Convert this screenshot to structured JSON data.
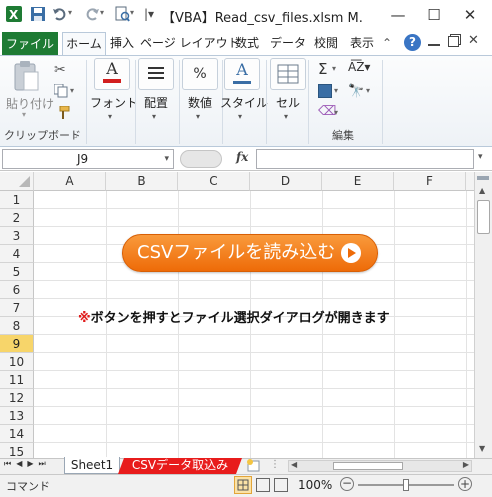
{
  "title_bar": {
    "title": "【VBA】Read_csv_files.xlsm M.",
    "minimize": "—",
    "maximize": "☐",
    "close": "✕"
  },
  "ribbon": {
    "file_tab": "ファイル",
    "tabs": [
      "ホーム",
      "挿入",
      "ページ レイアウト",
      "数式",
      "データ",
      "校閲",
      "表示"
    ],
    "groups": {
      "paste_label": "貼り付け",
      "clipboard_label": "クリップボード",
      "font_label": "フォント",
      "alignment_label": "配置",
      "number_label": "数値",
      "style_label": "スタイル",
      "cell_label": "セル",
      "editing_label": "編集"
    }
  },
  "formula_bar": {
    "name_box": "J9",
    "fx": "fx",
    "value": ""
  },
  "grid": {
    "columns": [
      "A",
      "B",
      "C",
      "D",
      "E",
      "F"
    ],
    "rows": [
      "1",
      "2",
      "3",
      "4",
      "5",
      "6",
      "7",
      "8",
      "9",
      "10",
      "11",
      "12",
      "13",
      "14",
      "15"
    ],
    "active_row": "9"
  },
  "sheet_content": {
    "button_label": "CSVファイルを読み込む",
    "note_mark": "※",
    "note_text": "ボタンを押すとファイル選択ダイアログが開きます"
  },
  "sheet_tabs": {
    "tabs": [
      "Sheet1",
      "CSVデータ取込み"
    ],
    "active": "Sheet1"
  },
  "status_bar": {
    "mode": "コマンド",
    "zoom": "100%"
  },
  "colors": {
    "file_tab": "#1e7b34",
    "button": "#ee6b08",
    "note_mark": "#e01c1c",
    "active_row_header": "#f7d56a",
    "sheet2_tab": "#e81c1c"
  }
}
